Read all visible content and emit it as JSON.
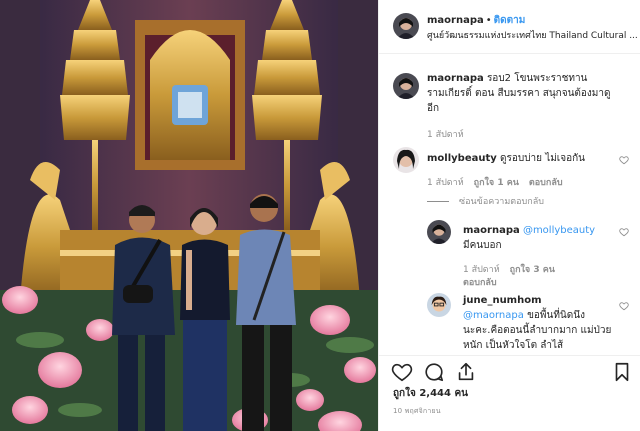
{
  "post": {
    "author": "maornapa",
    "follow_label": "ติดตาม",
    "location": "ศูนย์วัฒนธรรมแห่งประเทศไทย Thailand Cultural ...",
    "likes": "ถูกใจ 2,444 คน",
    "date": "10 พฤศจิกายน"
  },
  "comments": [
    {
      "user": "maornapa",
      "text": "รอบ2 โขนพระราชทาน รามเกียรติ์ ตอน สืบมรรคา สนุกจนต้องมาดูอีก",
      "time": "1 สัปดาห์"
    },
    {
      "user": "mollybeauty",
      "text": "ดูรอบบ่าย ไม่เจอกัน",
      "time": "1 สัปดาห์",
      "likes": "ถูกใจ 1 คน",
      "reply": "ตอบกลับ",
      "hide_replies": "ซ่อนข้อความตอบกลับ"
    },
    {
      "user": "maornapa",
      "mention": "@mollybeauty",
      "text": "มีคนบอก",
      "time": "1 สัปดาห์",
      "likes": "ถูกใจ 3 คน",
      "reply": "ตอบกลับ"
    },
    {
      "user": "june_numhom",
      "mention": "@maornapa",
      "text": "ขอพื้นที่นิดนึง นะคะ.คือตอนนี้ลำบากมาก แม่ป่วยหนัก เป็นหัวใจโต ลำไส้"
    }
  ],
  "icons": {
    "like": "heart-icon",
    "comment": "comment-icon",
    "share": "share-icon",
    "save": "bookmark-icon"
  },
  "colors": {
    "link": "#3897f0",
    "muted": "#8e8e8e",
    "text": "#262626"
  }
}
